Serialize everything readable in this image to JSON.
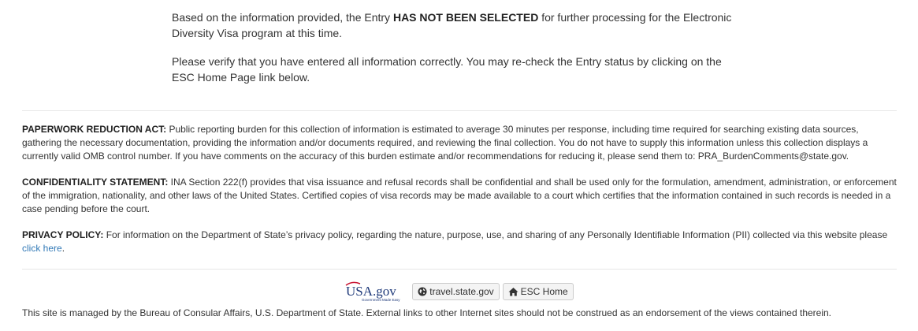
{
  "result": {
    "para1_prefix": "Based on the information provided, the Entry ",
    "para1_status": "HAS NOT BEEN SELECTED",
    "para1_suffix": " for further processing for the Electronic Diversity Visa program at this time.",
    "para2": "Please verify that you have entered all information correctly. You may re-check the Entry status by clicking on the ESC Home Page link below."
  },
  "notices": {
    "paperwork_title": "PAPERWORK REDUCTION ACT:",
    "paperwork_text": " Public reporting burden for this collection of information is estimated to average 30 minutes per response, including time required for searching existing data sources, gathering the necessary documentation, providing the information and/or documents required, and reviewing the final collection. You do not have to supply this information unless this collection displays a currently valid OMB control number. If you have comments on the accuracy of this burden estimate and/or recommendations for reducing it, please send them to: PRA_BurdenComments@state.gov.",
    "confidentiality_title": "CONFIDENTIALITY STATEMENT:",
    "confidentiality_text": " INA Section 222(f) provides that visa issuance and refusal records shall be confidential and shall be used only for the formulation, amendment, administration, or enforcement of the immigration, nationality, and other laws of the United States. Certified copies of visa records may be made available to a court which certifies that the information contained in such records is needed in a case pending before the court.",
    "privacy_title": "PRIVACY POLICY:",
    "privacy_text": " For information on the Department of State’s privacy policy, regarding the nature, purpose, use, and sharing of any Personally Identifiable Information (PII) collected via this website please ",
    "privacy_link": "click here",
    "privacy_end": "."
  },
  "footer": {
    "usagov_logo": "USA.gov",
    "usagov_tagline": "Government Made Easy",
    "travel_label": "travel.state.gov",
    "esc_home_label": "ESC Home",
    "note": "This site is managed by the Bureau of Consular Affairs, U.S. Department of State. External links to other Internet sites should not be construed as an endorsement of the views contained therein.",
    "icons": {
      "travel": "globe-icon",
      "esc_home": "home-icon"
    },
    "colors": {
      "link": "#337ab7",
      "usagov_blue": "#1f3a7a",
      "usagov_red": "#c8102e"
    }
  }
}
